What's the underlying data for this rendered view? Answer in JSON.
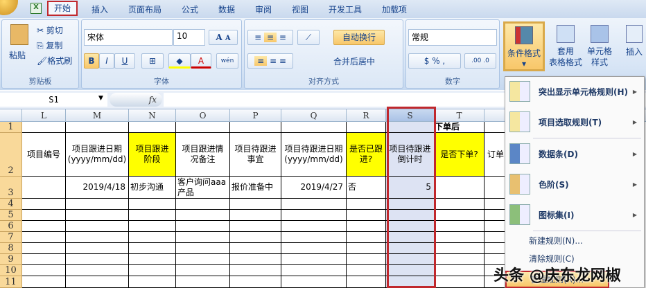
{
  "tabs": [
    "开始",
    "插入",
    "页面布局",
    "公式",
    "数据",
    "审阅",
    "视图",
    "开发工具",
    "加载项"
  ],
  "clipboard": {
    "paste": "粘贴",
    "cut": "剪切",
    "copy": "复制",
    "format_painter": "格式刷",
    "label": "剪贴板"
  },
  "font": {
    "name": "宋体",
    "size": "10",
    "label": "字体",
    "bold": "B",
    "italic": "I",
    "underline": "U",
    "grow": "A",
    "shrink": "A",
    "phonetic": "wén"
  },
  "alignment": {
    "wrap": "自动换行",
    "merge": "合并后居中",
    "label": "对齐方式"
  },
  "number": {
    "format": "常规",
    "percent": "%",
    "comma": ",",
    "inc": ".00",
    "dec": ".0",
    "label": "数字"
  },
  "styles": {
    "conditional": "条件格式",
    "table": "套用\n表格格式",
    "cell": "单元格\n样式",
    "insert": "插入"
  },
  "formula_bar": {
    "name_box": "S1",
    "fx": "fx",
    "value": ""
  },
  "columns": [
    "L",
    "M",
    "N",
    "O",
    "P",
    "Q",
    "R",
    "S",
    "T"
  ],
  "rows": [
    "1",
    "2",
    "3",
    "4",
    "5",
    "6",
    "7",
    "8",
    "9",
    "10",
    "11"
  ],
  "t1": "下单后",
  "headers": [
    "项目编号",
    "项目跟进日期(yyyy/mm/dd)",
    "项目跟进阶段",
    "项目跟进情况备注",
    "项目待跟进事宜",
    "项目待跟进日期(yyyy/mm/dd)",
    "是否已跟进?",
    "项目待跟进倒计时",
    "是否下单?",
    "订单"
  ],
  "row3": [
    "",
    "2019/4/18",
    "初步沟通",
    "客户询问aaa产品",
    "报价准备中",
    "2019/4/27",
    "否",
    "5",
    ""
  ],
  "menu": {
    "items": [
      "突出显示单元格规则(H)",
      "项目选取规则(T)",
      "数据条(D)",
      "色阶(S)",
      "图标集(I)"
    ],
    "new_rule": "新建规则(N)...",
    "clear_rule": "清除规则(C)",
    "manage_rule": "管理规则(R)..."
  },
  "watermark": "头条 @庆东龙网椒",
  "colors": {
    "accent_red": "#c0282d",
    "highlight": "#ffff00",
    "selection": "#dde3f3"
  }
}
